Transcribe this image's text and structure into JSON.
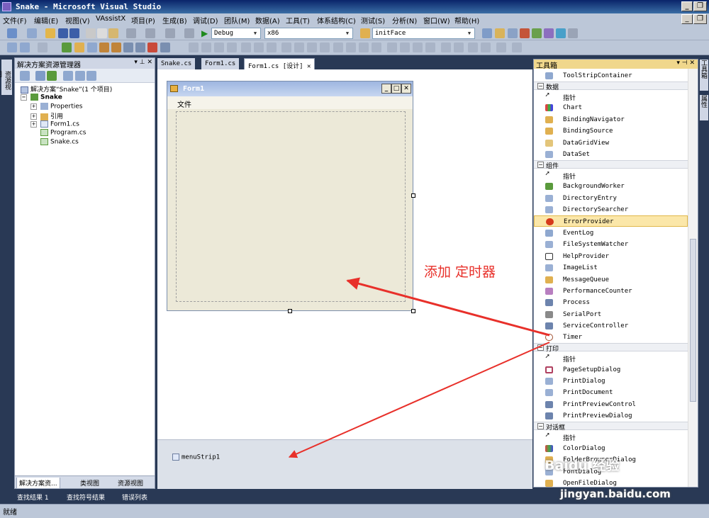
{
  "window": {
    "title": "Snake - Microsoft Visual Studio"
  },
  "menu": [
    "文件(F)",
    "编辑(E)",
    "视图(V)",
    "VAssistX",
    "项目(P)",
    "生成(B)",
    "调试(D)",
    "团队(M)",
    "数据(A)",
    "工具(T)",
    "体系结构(C)",
    "测试(S)",
    "分析(N)",
    "窗口(W)",
    "帮助(H)"
  ],
  "toolbar": {
    "config": "Debug",
    "platform": "x86",
    "find": "initFace"
  },
  "solution_explorer": {
    "title": "解决方案资源管理器",
    "solution": "解决方案“Snake”(1 个项目)",
    "project": "Snake",
    "items": [
      "Properties",
      "引用",
      "Form1.cs",
      "Program.cs",
      "Snake.cs"
    ],
    "tabs": [
      "解决方案资...",
      "类视图",
      "资源视图"
    ]
  },
  "doc_tabs": [
    "Snake.cs",
    "Form1.cs",
    "Form1.cs [设计]"
  ],
  "form": {
    "title": "Form1",
    "menu": "文件"
  },
  "tray": {
    "component": "menuStrip1"
  },
  "annotation": "添加 定时器",
  "toolbox": {
    "title": "工具箱",
    "top_item": "ToolStripContainer",
    "categories": [
      {
        "name": "数据",
        "items": [
          "指针",
          "Chart",
          "BindingNavigator",
          "BindingSource",
          "DataGridView",
          "DataSet"
        ]
      },
      {
        "name": "组件",
        "items": [
          "指针",
          "BackgroundWorker",
          "DirectoryEntry",
          "DirectorySearcher",
          "ErrorProvider",
          "EventLog",
          "FileSystemWatcher",
          "HelpProvider",
          "ImageList",
          "MessageQueue",
          "PerformanceCounter",
          "Process",
          "SerialPort",
          "ServiceController",
          "Timer"
        ]
      },
      {
        "name": "打印",
        "items": [
          "指针",
          "PageSetupDialog",
          "PrintDialog",
          "PrintDocument",
          "PrintPreviewControl",
          "PrintPreviewDialog"
        ]
      },
      {
        "name": "对话框",
        "items": [
          "指针",
          "ColorDialog",
          "FolderBrowserDialog",
          "FontDialog",
          "OpenFileDialog"
        ]
      }
    ],
    "selected": "ErrorProvider"
  },
  "left_strip_tab": "资源视图",
  "right_strip_tabs": [
    "工具箱",
    "属性"
  ],
  "output_tabs": [
    "查找结果 1",
    "查找符号结果",
    "错误列表"
  ],
  "status": "就绪",
  "watermark": {
    "text": "Baidu 经验",
    "url": "jingyan.baidu.com"
  },
  "colors": {
    "annotation": "#e8302a",
    "accent": "#293955",
    "selected": "#fbe7a9"
  }
}
